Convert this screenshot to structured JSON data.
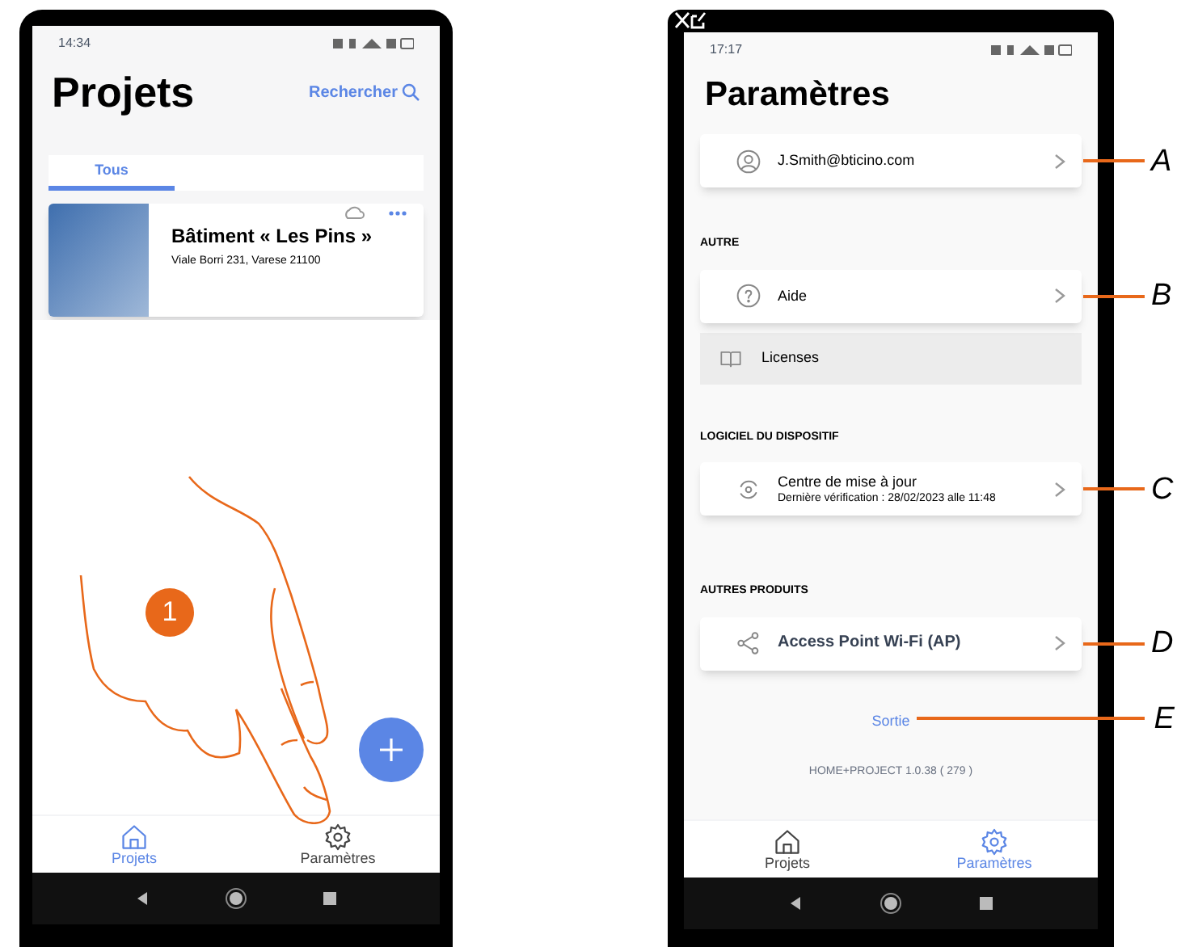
{
  "left_phone": {
    "status_bar": {
      "time": "14:34"
    },
    "title": "Projets",
    "search_link": "Rechercher",
    "tabs": [
      {
        "label": "Tous",
        "selected": true
      }
    ],
    "project_card": {
      "name": "Bâtiment « Les Pins »",
      "address": "Viale Borri 231, Varese 21100"
    },
    "step_badge": "1",
    "bottom_nav": [
      {
        "label": "Projets",
        "selected": true
      },
      {
        "label": "Paramètres",
        "selected": false
      }
    ]
  },
  "right_phone": {
    "status_bar": {
      "time": "17:17"
    },
    "title": "Paramètres",
    "sections": [
      {
        "items": [
          {
            "kind": "card",
            "label": "J.Smith@bticino.com",
            "callout": "A"
          }
        ]
      },
      {
        "header": "AUTRE",
        "items": [
          {
            "kind": "card",
            "label": "Aide",
            "callout": "B"
          },
          {
            "kind": "row",
            "label": "Licenses"
          }
        ]
      },
      {
        "header": "LOGICIEL DU DISPOSITIF",
        "items": [
          {
            "kind": "card",
            "label": "Centre de mise à jour",
            "subtitle": "Dernière vérification : 28/02/2023 alle 11:48",
            "callout": "C"
          }
        ]
      },
      {
        "header": "AUTRES PRODUITS",
        "items": [
          {
            "kind": "card",
            "label": "Access Point Wi-Fi (AP)",
            "callout": "D"
          }
        ]
      }
    ],
    "logout_link": {
      "label": "Sortie",
      "callout": "E"
    },
    "version": "HOME+PROJECT 1.0.38 ( 279 )",
    "bottom_nav": [
      {
        "label": "Projets",
        "selected": false
      },
      {
        "label": "Paramètres",
        "selected": true
      }
    ]
  }
}
